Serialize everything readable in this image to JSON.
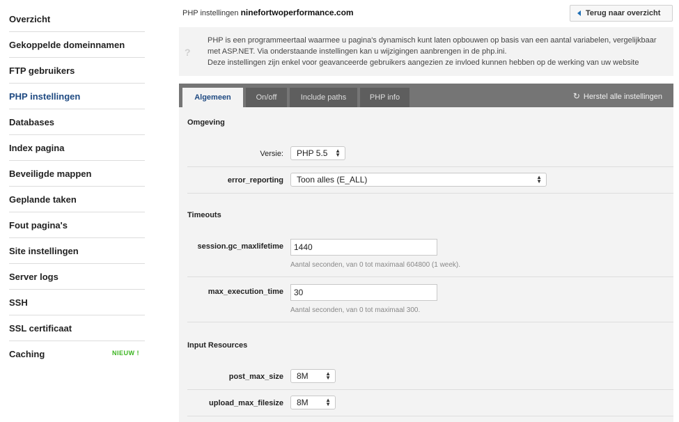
{
  "sidebar": {
    "items": [
      {
        "label": "Overzicht"
      },
      {
        "label": "Gekoppelde domeinnamen"
      },
      {
        "label": "FTP gebruikers"
      },
      {
        "label": "PHP instellingen"
      },
      {
        "label": "Databases"
      },
      {
        "label": "Index pagina"
      },
      {
        "label": "Beveiligde mappen"
      },
      {
        "label": "Geplande taken"
      },
      {
        "label": "Fout pagina's"
      },
      {
        "label": "Site instellingen"
      },
      {
        "label": "Server logs"
      },
      {
        "label": "SSH"
      },
      {
        "label": "SSL certificaat"
      },
      {
        "label": "Caching",
        "badge": "NIEUW !"
      }
    ]
  },
  "header": {
    "title_prefix": "PHP instellingen",
    "domain": "ninefortwoperformance.com",
    "back_label": "Terug naar overzicht"
  },
  "info": {
    "icon": "?",
    "line1": "PHP is een programmeertaal waarmee u pagina's dynamisch kunt laten opbouwen op basis van een aantal variabelen, vergelijkbaar met ASP.NET. Via onderstaande instellingen kan u wijzigingen aanbrengen in de php.ini.",
    "line2": "Deze instellingen zijn enkel voor geavanceerde gebruikers aangezien ze invloed kunnen hebben op de werking van uw website"
  },
  "tabs": [
    {
      "label": "Algemeen"
    },
    {
      "label": "On/off"
    },
    {
      "label": "Include paths"
    },
    {
      "label": "PHP info"
    }
  ],
  "reset_label": "Herstel alle instellingen",
  "form": {
    "omgeving": {
      "title": "Omgeving",
      "versie_label": "Versie:",
      "versie_value": "PHP 5.5",
      "error_label": "error_reporting",
      "error_value": "Toon alles (E_ALL)"
    },
    "timeouts": {
      "title": "Timeouts",
      "gc_label": "session.gc_maxlifetime",
      "gc_value": "1440",
      "gc_help": "Aantal seconden, van 0 tot maximaal 604800 (1 week).",
      "exec_label": "max_execution_time",
      "exec_value": "30",
      "exec_help": "Aantal seconden, van 0 tot maximaal 300."
    },
    "resources": {
      "title": "Input Resources",
      "post_label": "post_max_size",
      "post_value": "8M",
      "upload_label": "upload_max_filesize",
      "upload_value": "8M"
    }
  },
  "colors": {
    "active_nav": "#1f4a82",
    "badge": "#3cb521",
    "tabbar": "#757575",
    "panel": "#f3f3f3"
  }
}
